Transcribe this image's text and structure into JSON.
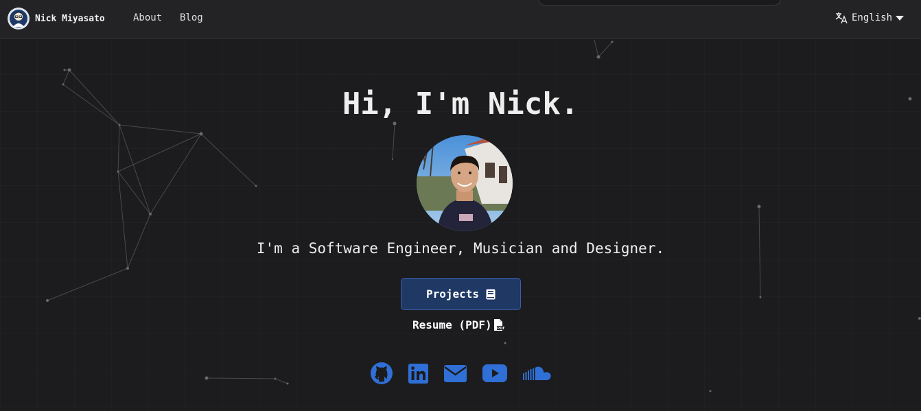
{
  "nav": {
    "brand_name": "Nick Miyasato",
    "links": [
      {
        "label": "About",
        "icon": "none"
      },
      {
        "label": "Blog",
        "icon": "none"
      }
    ],
    "language": {
      "selected": "English",
      "icon": "translate-icon"
    }
  },
  "hero": {
    "title": "Hi, I'm Nick.",
    "avatar_alt": "Portrait photo of Nick",
    "tagline": "I'm a Software Engineer, Musician and Designer.",
    "projects_label": "Projects",
    "resume_label": "Resume (PDF)"
  },
  "social_links": [
    {
      "name": "GitHub",
      "icon": "github-icon"
    },
    {
      "name": "LinkedIn",
      "icon": "linkedin-icon"
    },
    {
      "name": "Email",
      "icon": "envelope-icon"
    },
    {
      "name": "YouTube",
      "icon": "youtube-icon"
    },
    {
      "name": "SoundCloud",
      "icon": "soundcloud-icon"
    }
  ],
  "colors": {
    "background": "#1c1c1e",
    "navbar": "#232325",
    "accent_blue": "#2f6fd6",
    "button_bg": "#1f3864",
    "text": "#eeeeee"
  }
}
